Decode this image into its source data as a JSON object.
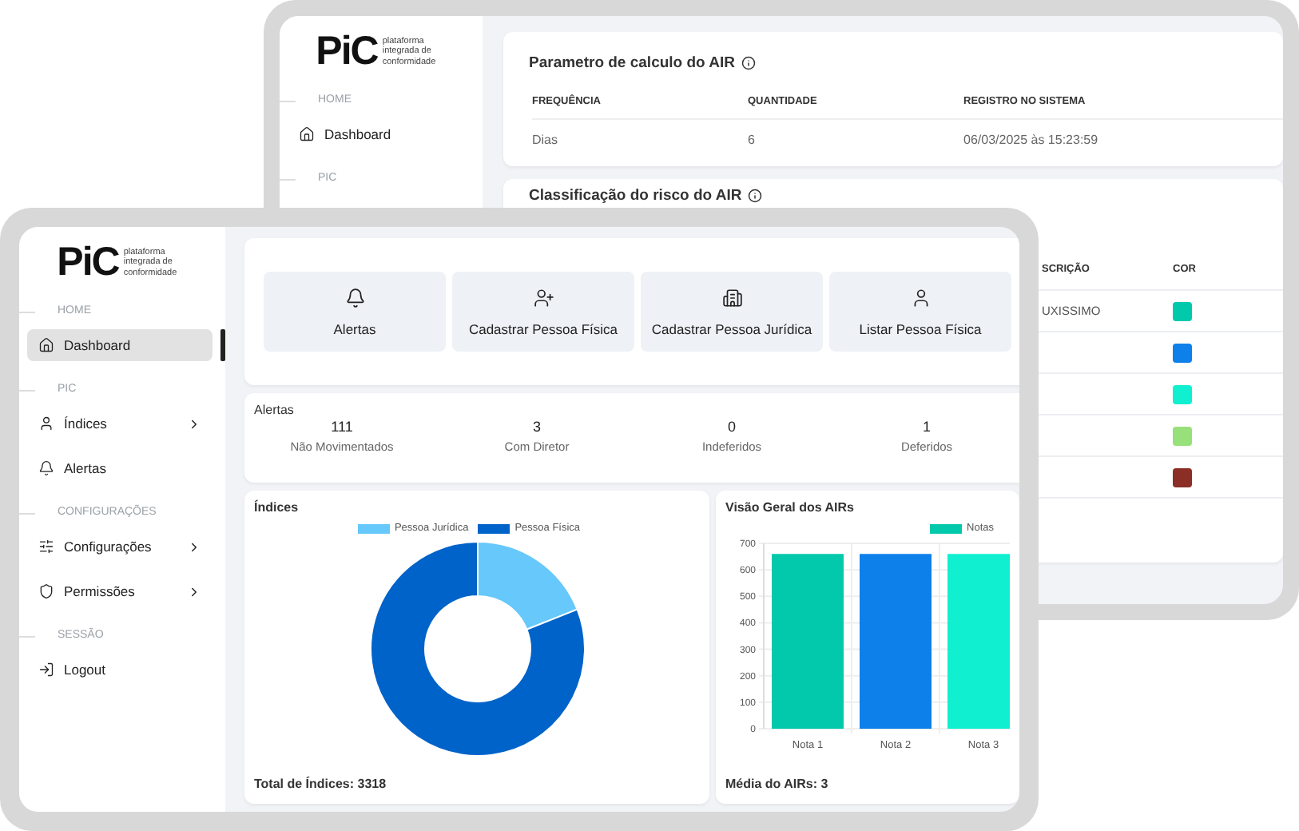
{
  "back_window": {
    "sidebar": {
      "logo": {
        "mark": "PiC",
        "tagline": "plataforma integrada de conformidade"
      },
      "sections": [
        {
          "label": "HOME",
          "items": [
            {
              "label": "Dashboard",
              "kind": "home",
              "selected": false,
              "has_submenu": false
            }
          ]
        },
        {
          "label": "PIC"
        }
      ]
    },
    "parameter_card": {
      "title": "Parametro de calculo do AIR",
      "columns": [
        "FREQUÊNCIA",
        "QUANTIDADE",
        "REGISTRO NO SISTEMA"
      ],
      "rows": [
        [
          "Dias",
          "6",
          "06/03/2025 às 15:23:59"
        ]
      ]
    },
    "risk_card": {
      "title": "Classificação do risco do AIR",
      "columns": [
        "SCRIÇÃO",
        "COR"
      ],
      "rows": [
        {
          "description": "UXISSIMO",
          "color": "#03c9ac"
        },
        {
          "color": "#0d80ea"
        },
        {
          "color": "#10f0d0"
        },
        {
          "color": "#98e07a"
        },
        {
          "color": "#8b2e26"
        }
      ]
    }
  },
  "front_window": {
    "sidebar": {
      "logo": {
        "mark": "PiC",
        "tagline": "plataforma integrada de conformidade"
      },
      "sections": [
        {
          "label": "HOME",
          "items": [
            {
              "label": "Dashboard",
              "kind": "home",
              "selected": true,
              "has_submenu": false
            }
          ]
        },
        {
          "label": "PIC",
          "items": [
            {
              "label": "Índices",
              "kind": "user",
              "selected": false,
              "has_submenu": true
            },
            {
              "label": "Alertas",
              "kind": "bell",
              "selected": false,
              "has_submenu": false
            }
          ]
        },
        {
          "label": "CONFIGURAÇÕES",
          "items": [
            {
              "label": "Configurações",
              "kind": "sliders",
              "selected": false,
              "has_submenu": true
            },
            {
              "label": "Permissões",
              "kind": "shield",
              "selected": false,
              "has_submenu": true
            }
          ]
        },
        {
          "label": "SESSÃO",
          "items": [
            {
              "label": "Logout",
              "kind": "logout",
              "selected": false,
              "has_submenu": false
            }
          ]
        }
      ]
    },
    "quick_actions": [
      {
        "label": "Alertas",
        "kind": "bell"
      },
      {
        "label": "Cadastrar Pessoa Física",
        "kind": "userplus"
      },
      {
        "label": "Cadastrar Pessoa Jurídica",
        "kind": "building"
      },
      {
        "label": "Listar Pessoa Física",
        "kind": "user"
      }
    ],
    "alerts": {
      "title": "Alertas",
      "stats": [
        {
          "value": "111",
          "label": "Não Movimentados"
        },
        {
          "value": "3",
          "label": "Com Diretor"
        },
        {
          "value": "0",
          "label": "Indeferidos"
        },
        {
          "value": "1",
          "label": "Deferidos"
        }
      ]
    },
    "indices": {
      "title": "Índices",
      "legend": [
        {
          "label": "Pessoa Jurídica",
          "color": "#66c8fb"
        },
        {
          "label": "Pessoa Física",
          "color": "#0063c9"
        }
      ],
      "total": "Total de Índices: 3318"
    },
    "overview": {
      "title": "Visão Geral dos AIRs",
      "bars": [
        {
          "color": "#03c9ac"
        },
        {
          "color": "#0d80ea"
        },
        {
          "color": "#10f0d0"
        }
      ],
      "chart_data": {
        "type": "bar",
        "categories": [
          "Nota 1",
          "Nota 2",
          "Nota 3"
        ],
        "series": [
          {
            "name": "Notas",
            "values": [
              660,
              660,
              660
            ]
          }
        ],
        "ylim": [
          0,
          700
        ],
        "yticks": [
          0,
          100,
          200,
          300,
          400,
          500,
          600,
          700
        ],
        "grid": true
      },
      "footer": "Média do AIRs: 3"
    }
  }
}
